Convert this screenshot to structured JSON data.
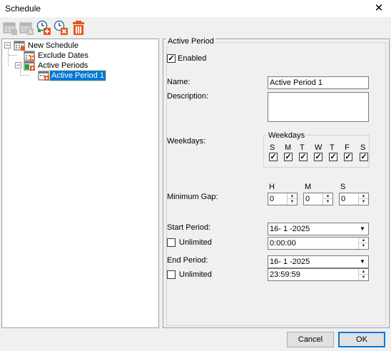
{
  "window": {
    "title": "Schedule",
    "close_glyph": "✕"
  },
  "toolbar": {
    "buttons": [
      {
        "name": "add-schedule-icon",
        "enabled": false
      },
      {
        "name": "remove-schedule-icon",
        "enabled": false
      },
      {
        "name": "add-period-icon",
        "enabled": true
      },
      {
        "name": "remove-period-icon",
        "enabled": true
      },
      {
        "name": "trash-icon",
        "enabled": true
      }
    ]
  },
  "tree": {
    "root": "New Schedule",
    "exclude": "Exclude Dates",
    "active": "Active Periods",
    "period": "Active Period 1",
    "expanded_glyph": "−"
  },
  "panel": {
    "group_title": "Active Period",
    "enabled_label": "Enabled",
    "enabled_checked": true,
    "name_label": "Name:",
    "name_value": "Active Period 1",
    "description_label": "Description:",
    "description_value": "",
    "weekdays_label": "Weekdays:",
    "weekdays_group_title": "Weekdays",
    "weekdays": [
      {
        "day": "S",
        "checked": true
      },
      {
        "day": "M",
        "checked": true
      },
      {
        "day": "T",
        "checked": true
      },
      {
        "day": "W",
        "checked": true
      },
      {
        "day": "T",
        "checked": true
      },
      {
        "day": "F",
        "checked": true
      },
      {
        "day": "S",
        "checked": true
      }
    ],
    "min_gap_label": "Minimum Gap:",
    "gap_h_label": "H",
    "gap_m_label": "M",
    "gap_s_label": "S",
    "gap_h": "0",
    "gap_m": "0",
    "gap_s": "0",
    "start_label": "Start Period:",
    "start_date": "16- 1 -2025",
    "start_unlimited_label": "Unlimited",
    "start_time": "0:00:00",
    "end_label": "End Period:",
    "end_date": "16- 1 -2025",
    "end_unlimited_label": "Unlimited",
    "end_time": "23:59:59"
  },
  "footer": {
    "cancel": "Cancel",
    "ok": "OK"
  },
  "colors": {
    "selection": "#0078d7",
    "accent_orange": "#e8541e",
    "icon_green": "#2e9e3e"
  }
}
